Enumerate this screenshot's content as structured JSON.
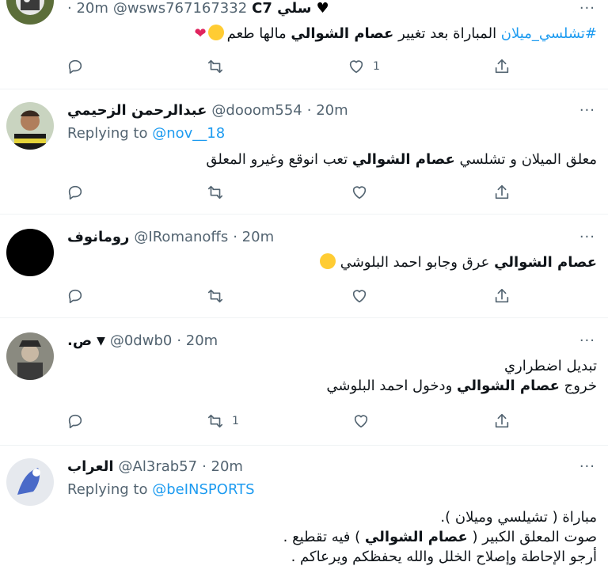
{
  "tweets": [
    {
      "name": "سلي C7",
      "handle": "@wsws767167332",
      "time": "· 20m",
      "body_lines": [
        {
          "parts": [
            {
              "t": "#تشلسي_ميلان",
              "style": "hashtag"
            },
            {
              "t": " المباراة بعد تغيير ",
              "style": ""
            },
            {
              "t": "عصام الشوالي",
              "style": "bold"
            },
            {
              "t": " مالها طعم",
              "style": ""
            }
          ]
        }
      ],
      "emojis": [
        "crying-face-icon",
        "broken-heart-icon"
      ],
      "counts": {
        "reply": "",
        "retweet": "",
        "like": "1"
      }
    },
    {
      "name": "عبدالرحمن الزحيمي",
      "handle": "@dooom554",
      "time": "· 20m",
      "replying_label": "Replying to",
      "replying_to": "@nov__18",
      "body_lines": [
        {
          "parts": [
            {
              "t": "معلق الميلان و تشلسي ",
              "style": ""
            },
            {
              "t": "عصام الشوالي",
              "style": "bold"
            },
            {
              "t": " تعب انوقع وغيرو المعلق",
              "style": ""
            }
          ]
        }
      ],
      "counts": {
        "reply": "",
        "retweet": "",
        "like": ""
      }
    },
    {
      "name": "رومانوف",
      "handle": "@IRomanoffs",
      "time": "· 20m",
      "body_lines": [
        {
          "parts": [
            {
              "t": "عصام الشوالي",
              "style": "bold"
            },
            {
              "t": " عرق وجابو احمد البلوشي",
              "style": ""
            }
          ]
        }
      ],
      "emojis": [
        "laughing-tears-icon"
      ],
      "counts": {
        "reply": "",
        "retweet": "",
        "like": ""
      }
    },
    {
      "name": "ص.",
      "handle": "@0dwb0",
      "time": "· 20m",
      "body_lines": [
        {
          "parts": [
            {
              "t": "تبديل اضطراري",
              "style": ""
            }
          ]
        },
        {
          "parts": [
            {
              "t": "خروج ",
              "style": ""
            },
            {
              "t": "عصام الشوالي",
              "style": "bold"
            },
            {
              "t": " ودخول احمد البلوشي",
              "style": ""
            }
          ]
        }
      ],
      "counts": {
        "reply": "",
        "retweet": "1",
        "like": ""
      }
    },
    {
      "name": "العراب",
      "handle": "@Al3rab57",
      "time": "· 20m",
      "replying_label": "Replying to",
      "replying_to": "@beINSPORTS",
      "body_lines": [
        {
          "parts": [
            {
              "t": "مباراة ( تشيلسي وميلان ).",
              "style": ""
            }
          ]
        },
        {
          "parts": [
            {
              "t": "صوت المعلق الكبير ( ",
              "style": ""
            },
            {
              "t": "عصام الشوالي",
              "style": "bold"
            },
            {
              "t": " ) فيه تقطيع .",
              "style": ""
            }
          ]
        },
        {
          "parts": [
            {
              "t": "أرجو الإحاطة وإصلاح الخلل والله يحفظكم ويرعاكم .",
              "style": ""
            }
          ]
        }
      ]
    }
  ],
  "colors": {
    "accent": "#1d9bf0",
    "muted": "#536471",
    "text": "#0f1419",
    "border": "#eff3f4"
  }
}
